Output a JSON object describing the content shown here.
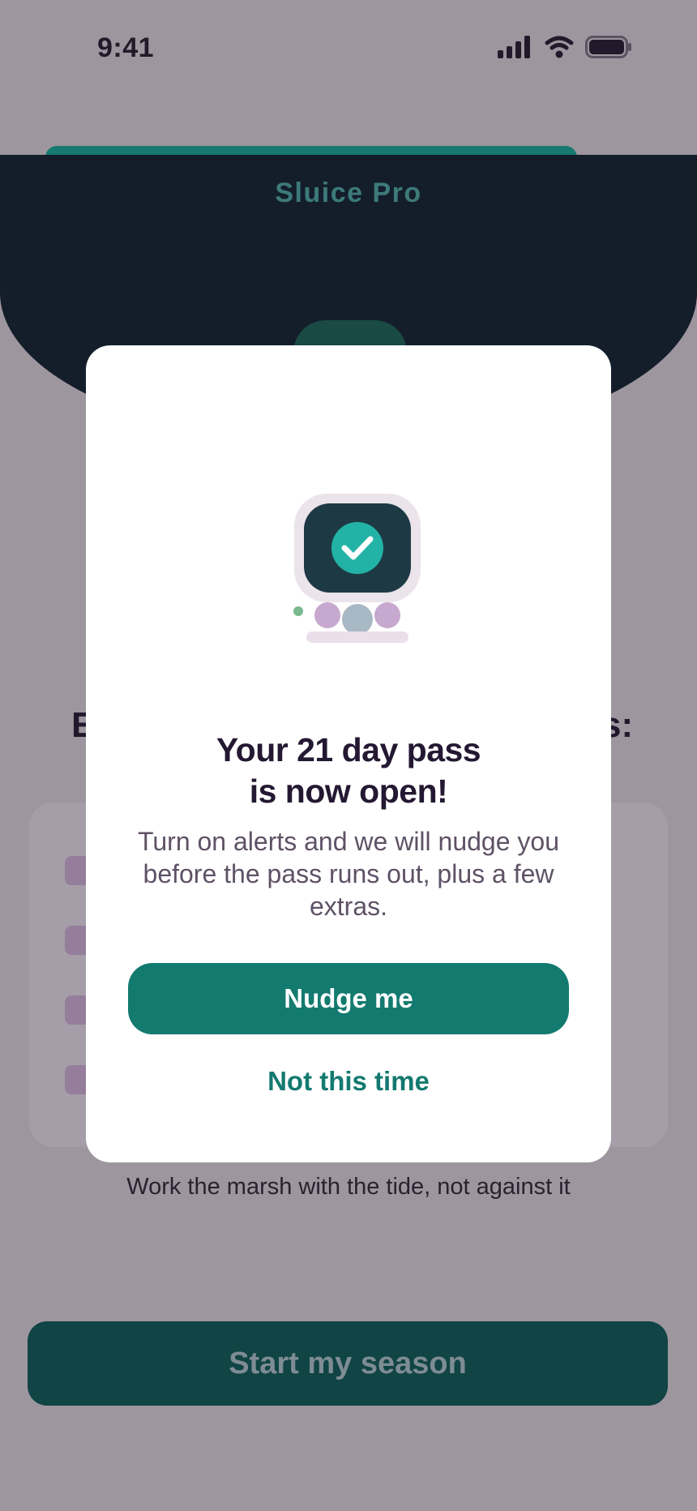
{
  "status_bar": {
    "time": "9:41"
  },
  "hero": {
    "title": "Sluice Pro"
  },
  "background": {
    "heading_left": "E",
    "heading_right": "s:",
    "tagline": "Work the marsh with the tide, not against it",
    "cta_label": "Start my season"
  },
  "modal": {
    "title_line1": "Your 21 day pass",
    "title_line2": "is now open!",
    "body": "Turn on alerts and we will nudge you before the pass runs out, plus a few extras.",
    "primary_button": "Nudge me",
    "secondary_button": "Not this time",
    "illustration_icon": "check-icon"
  },
  "colors": {
    "accent": "#137a70",
    "hero_background": "#141e2b",
    "dim_overlay": "#9e969e"
  }
}
